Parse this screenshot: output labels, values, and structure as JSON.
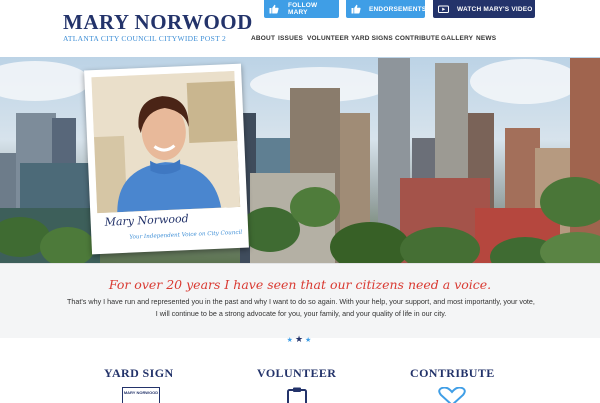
{
  "header": {
    "logo_name": "MARY NORWOOD",
    "logo_sub": "ATLANTA CITY COUNCIL CITYWIDE POST 2",
    "follow_label": "FOLLOW MARY",
    "endorse_label": "ENDORSEMENTS",
    "video_label": "WATCH MARY'S VIDEO"
  },
  "nav": {
    "items": [
      "ABOUT",
      "ISSUES",
      "VOLUNTEER",
      "YARD SIGNS",
      "CONTRIBUTE",
      "GALLERY",
      "NEWS"
    ]
  },
  "hero": {
    "signature": "Mary Norwood",
    "tagline": "Your Independent Voice on City Council"
  },
  "quote": {
    "title": "For over 20 years I have seen that our citizens need a voice.",
    "text": "That's why I have run and represented you in the past and why I want to do so again. With your help, your support, and most importantly, your vote, I will continue to be a strong advocate for you, your family, and your quality of life in our city."
  },
  "features": {
    "yard_sign": "YARD SIGN",
    "volunteer": "VOLUNTEER",
    "contribute": "CONTRIBUTE",
    "sign_mini_text": "MARY NORWOOD"
  },
  "colors": {
    "navy": "#23336a",
    "blue": "#3f9ee6",
    "red": "#d93a32"
  },
  "icons": {
    "follow": "thumbs-up-icon",
    "endorse": "thumbs-up-icon",
    "video": "video-icon",
    "volunteer": "clipboard-icon",
    "contribute": "heart-icon"
  }
}
